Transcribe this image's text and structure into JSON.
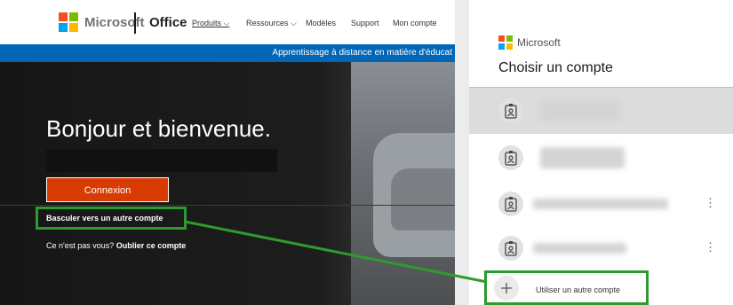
{
  "office_site": {
    "brand": "Microsoft",
    "product": "Office",
    "nav": [
      "Produits ⌵",
      "Ressources ⌵",
      "Modèles",
      "Support",
      "Mon compte"
    ],
    "banner": "Apprentissage à distance en matière d'éducat",
    "heading": "Bonjour et bienvenue.",
    "signin_button": "Connexion",
    "switch_account_link": "Basculer vers un autre compte",
    "not_you_text": "Ce n'est pas vous?",
    "forget_account_link": "Oublier ce compte"
  },
  "account_picker": {
    "brand": "Microsoft",
    "title": "Choisir un compte",
    "kebab": "⋮",
    "add_account_label": "Utiliser un autre compte"
  },
  "colors": {
    "ms_red": "#f25022",
    "ms_green": "#7fba00",
    "ms_blue": "#00a4ef",
    "ms_yellow": "#ffb900",
    "highlight": "#2e9b2e",
    "signin": "#d83b01"
  }
}
